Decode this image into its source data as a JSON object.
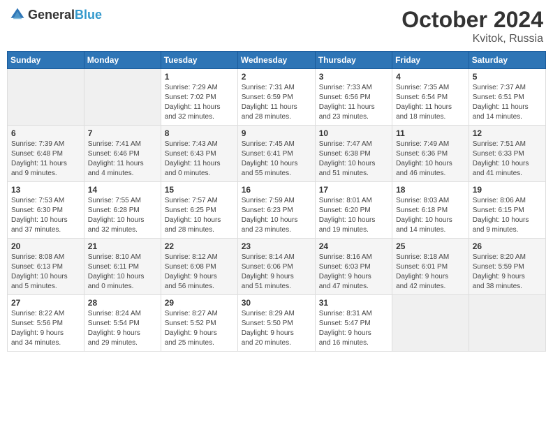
{
  "logo": {
    "text_general": "General",
    "text_blue": "Blue"
  },
  "header": {
    "month": "October 2024",
    "location": "Kvitok, Russia"
  },
  "weekdays": [
    "Sunday",
    "Monday",
    "Tuesday",
    "Wednesday",
    "Thursday",
    "Friday",
    "Saturday"
  ],
  "weeks": [
    [
      {
        "day": "",
        "detail": ""
      },
      {
        "day": "",
        "detail": ""
      },
      {
        "day": "1",
        "detail": "Sunrise: 7:29 AM\nSunset: 7:02 PM\nDaylight: 11 hours\nand 32 minutes."
      },
      {
        "day": "2",
        "detail": "Sunrise: 7:31 AM\nSunset: 6:59 PM\nDaylight: 11 hours\nand 28 minutes."
      },
      {
        "day": "3",
        "detail": "Sunrise: 7:33 AM\nSunset: 6:56 PM\nDaylight: 11 hours\nand 23 minutes."
      },
      {
        "day": "4",
        "detail": "Sunrise: 7:35 AM\nSunset: 6:54 PM\nDaylight: 11 hours\nand 18 minutes."
      },
      {
        "day": "5",
        "detail": "Sunrise: 7:37 AM\nSunset: 6:51 PM\nDaylight: 11 hours\nand 14 minutes."
      }
    ],
    [
      {
        "day": "6",
        "detail": "Sunrise: 7:39 AM\nSunset: 6:48 PM\nDaylight: 11 hours\nand 9 minutes."
      },
      {
        "day": "7",
        "detail": "Sunrise: 7:41 AM\nSunset: 6:46 PM\nDaylight: 11 hours\nand 4 minutes."
      },
      {
        "day": "8",
        "detail": "Sunrise: 7:43 AM\nSunset: 6:43 PM\nDaylight: 11 hours\nand 0 minutes."
      },
      {
        "day": "9",
        "detail": "Sunrise: 7:45 AM\nSunset: 6:41 PM\nDaylight: 10 hours\nand 55 minutes."
      },
      {
        "day": "10",
        "detail": "Sunrise: 7:47 AM\nSunset: 6:38 PM\nDaylight: 10 hours\nand 51 minutes."
      },
      {
        "day": "11",
        "detail": "Sunrise: 7:49 AM\nSunset: 6:36 PM\nDaylight: 10 hours\nand 46 minutes."
      },
      {
        "day": "12",
        "detail": "Sunrise: 7:51 AM\nSunset: 6:33 PM\nDaylight: 10 hours\nand 41 minutes."
      }
    ],
    [
      {
        "day": "13",
        "detail": "Sunrise: 7:53 AM\nSunset: 6:30 PM\nDaylight: 10 hours\nand 37 minutes."
      },
      {
        "day": "14",
        "detail": "Sunrise: 7:55 AM\nSunset: 6:28 PM\nDaylight: 10 hours\nand 32 minutes."
      },
      {
        "day": "15",
        "detail": "Sunrise: 7:57 AM\nSunset: 6:25 PM\nDaylight: 10 hours\nand 28 minutes."
      },
      {
        "day": "16",
        "detail": "Sunrise: 7:59 AM\nSunset: 6:23 PM\nDaylight: 10 hours\nand 23 minutes."
      },
      {
        "day": "17",
        "detail": "Sunrise: 8:01 AM\nSunset: 6:20 PM\nDaylight: 10 hours\nand 19 minutes."
      },
      {
        "day": "18",
        "detail": "Sunrise: 8:03 AM\nSunset: 6:18 PM\nDaylight: 10 hours\nand 14 minutes."
      },
      {
        "day": "19",
        "detail": "Sunrise: 8:06 AM\nSunset: 6:15 PM\nDaylight: 10 hours\nand 9 minutes."
      }
    ],
    [
      {
        "day": "20",
        "detail": "Sunrise: 8:08 AM\nSunset: 6:13 PM\nDaylight: 10 hours\nand 5 minutes."
      },
      {
        "day": "21",
        "detail": "Sunrise: 8:10 AM\nSunset: 6:11 PM\nDaylight: 10 hours\nand 0 minutes."
      },
      {
        "day": "22",
        "detail": "Sunrise: 8:12 AM\nSunset: 6:08 PM\nDaylight: 9 hours\nand 56 minutes."
      },
      {
        "day": "23",
        "detail": "Sunrise: 8:14 AM\nSunset: 6:06 PM\nDaylight: 9 hours\nand 51 minutes."
      },
      {
        "day": "24",
        "detail": "Sunrise: 8:16 AM\nSunset: 6:03 PM\nDaylight: 9 hours\nand 47 minutes."
      },
      {
        "day": "25",
        "detail": "Sunrise: 8:18 AM\nSunset: 6:01 PM\nDaylight: 9 hours\nand 42 minutes."
      },
      {
        "day": "26",
        "detail": "Sunrise: 8:20 AM\nSunset: 5:59 PM\nDaylight: 9 hours\nand 38 minutes."
      }
    ],
    [
      {
        "day": "27",
        "detail": "Sunrise: 8:22 AM\nSunset: 5:56 PM\nDaylight: 9 hours\nand 34 minutes."
      },
      {
        "day": "28",
        "detail": "Sunrise: 8:24 AM\nSunset: 5:54 PM\nDaylight: 9 hours\nand 29 minutes."
      },
      {
        "day": "29",
        "detail": "Sunrise: 8:27 AM\nSunset: 5:52 PM\nDaylight: 9 hours\nand 25 minutes."
      },
      {
        "day": "30",
        "detail": "Sunrise: 8:29 AM\nSunset: 5:50 PM\nDaylight: 9 hours\nand 20 minutes."
      },
      {
        "day": "31",
        "detail": "Sunrise: 8:31 AM\nSunset: 5:47 PM\nDaylight: 9 hours\nand 16 minutes."
      },
      {
        "day": "",
        "detail": ""
      },
      {
        "day": "",
        "detail": ""
      }
    ]
  ]
}
